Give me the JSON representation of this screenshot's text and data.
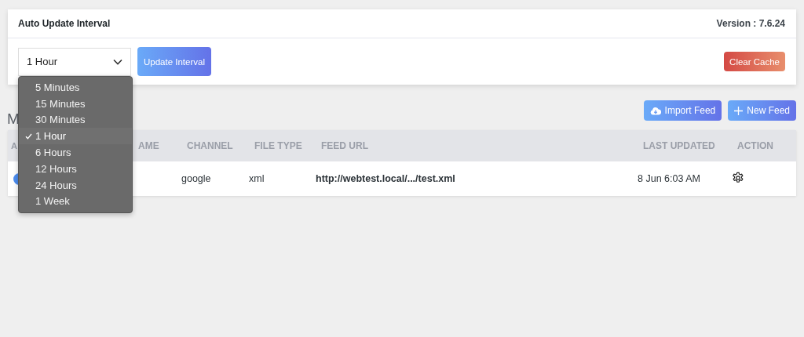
{
  "settings_card": {
    "title": "Auto Update Interval",
    "version": "Version : 7.6.24",
    "interval_select": {
      "value": "1 Hour",
      "options": [
        {
          "label": "5 Minutes",
          "selected": false
        },
        {
          "label": "15 Minutes",
          "selected": false
        },
        {
          "label": "30 Minutes",
          "selected": false
        },
        {
          "label": "1 Hour",
          "selected": true
        },
        {
          "label": "6 Hours",
          "selected": false
        },
        {
          "label": "12 Hours",
          "selected": false
        },
        {
          "label": "24 Hours",
          "selected": false
        },
        {
          "label": "1 Week",
          "selected": false
        }
      ]
    },
    "update_button": "Update Interval",
    "clear_cache_button": "Clear Cache"
  },
  "feeds_heading": "M",
  "toolbar": {
    "import_button": "Import Feed",
    "new_button": "New Feed"
  },
  "table": {
    "columns": [
      "A",
      "AME",
      "CHANNEL",
      "FILE TYPE",
      "FEED URL",
      "LAST UPDATED",
      "ACTION"
    ],
    "rows": [
      {
        "active": true,
        "channel": "google",
        "file_type": "xml",
        "feed_url": "http://webtest.local/.../test.xml",
        "last_updated": "8 Jun 6:03 AM"
      }
    ]
  }
}
